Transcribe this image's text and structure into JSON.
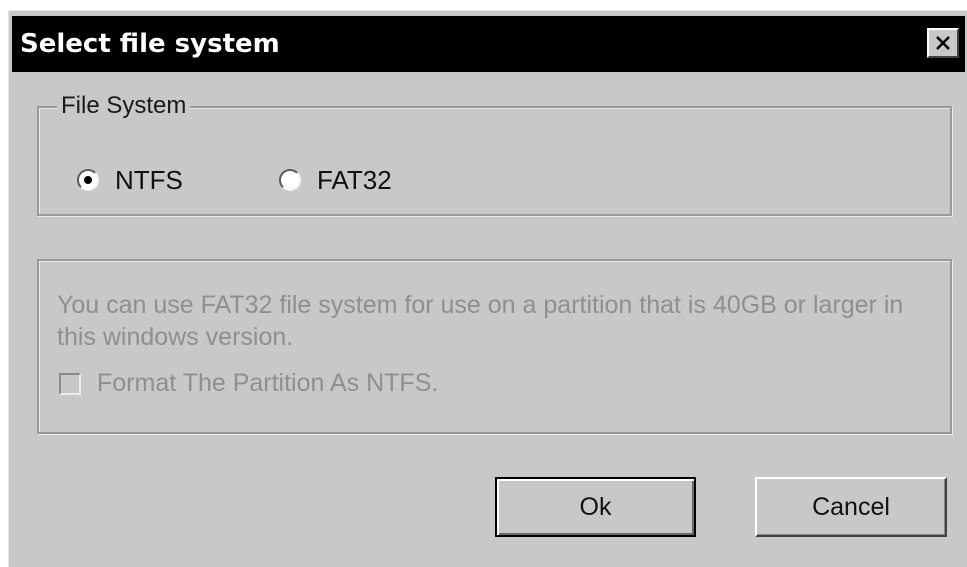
{
  "dialog": {
    "title": "Select file system",
    "close_icon": "close-x-icon"
  },
  "file_system_group": {
    "legend": "File System",
    "options": [
      {
        "label": "NTFS",
        "selected": true
      },
      {
        "label": "FAT32",
        "selected": false
      }
    ]
  },
  "info_group": {
    "message": "You can use FAT32 file system for use on a partition that is 40GB or larger in this windows version.",
    "checkbox_label": "Format The Partition As NTFS.",
    "checkbox_checked": false,
    "disabled": true
  },
  "buttons": {
    "ok_label": "Ok",
    "cancel_label": "Cancel"
  },
  "colors": {
    "dialog_bg": "#c8c8c8",
    "titlebar_bg": "#000000",
    "disabled_text": "#8f8f8f"
  }
}
